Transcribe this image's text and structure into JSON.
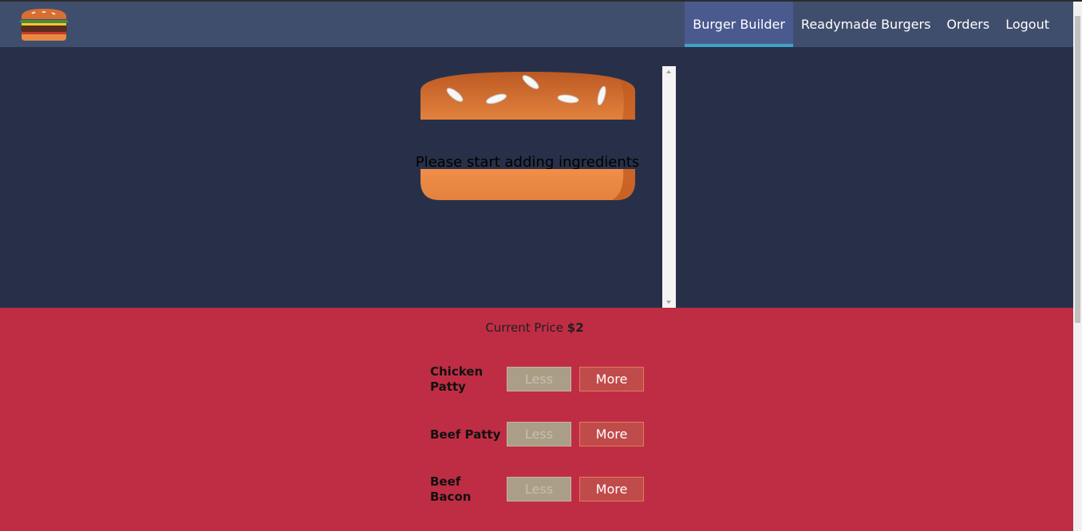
{
  "header": {
    "logo_icon": "burger-logo-icon",
    "nav": [
      {
        "label": "Burger Builder",
        "active": true
      },
      {
        "label": "Readymade Burgers",
        "active": false
      },
      {
        "label": "Orders",
        "active": false
      },
      {
        "label": "Logout",
        "active": false
      }
    ]
  },
  "burger": {
    "prompt": "Please start adding ingredients"
  },
  "controls": {
    "price_label": "Current Price",
    "price_value": "$2",
    "ingredients": [
      {
        "label_line1": "Chicken",
        "label_line2": "Patty",
        "less": "Less",
        "more": "More"
      },
      {
        "label_line1": "Beef Patty",
        "label_line2": "",
        "less": "Less",
        "more": "More"
      },
      {
        "label_line1": "Beef",
        "label_line2": "Bacon",
        "less": "Less",
        "more": "More"
      }
    ]
  },
  "colors": {
    "toolbar": "#404e6d",
    "nav_active": "#4a5a8f",
    "nav_indicator": "#40a4c8",
    "burger_bg": "#283049",
    "controls_bg": "#bf2d44",
    "less_btn": "#ab9e87",
    "more_btn": "#c04b4b",
    "bun": "#e27b36"
  }
}
